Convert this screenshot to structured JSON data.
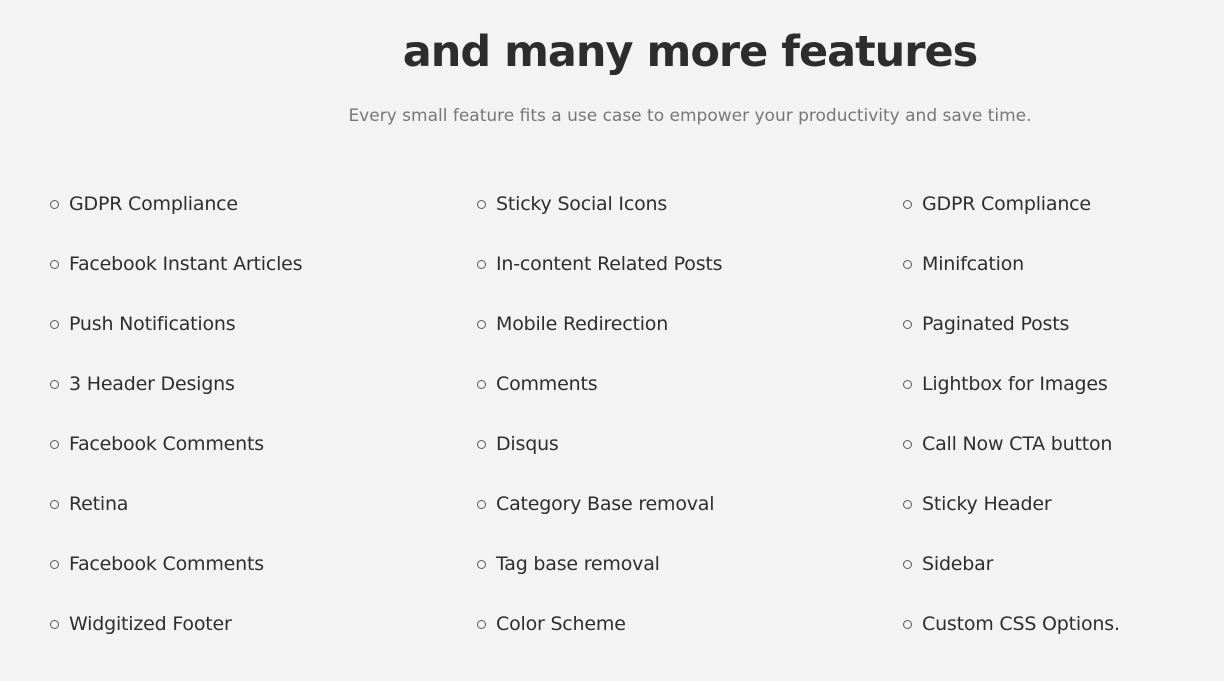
{
  "header": {
    "title": "and many more features",
    "subtitle": "Every small feature fits a use case to empower your productivity and save time."
  },
  "features": {
    "columns": [
      {
        "items": [
          {
            "label": "GDPR Compliance"
          },
          {
            "label": "Facebook Instant Articles"
          },
          {
            "label": "Push Notifications"
          },
          {
            "label": "3 Header Designs"
          },
          {
            "label": "Facebook Comments"
          },
          {
            "label": "Retina"
          },
          {
            "label": "Facebook Comments"
          },
          {
            "label": "Widgitized Footer"
          }
        ]
      },
      {
        "items": [
          {
            "label": "Sticky Social Icons"
          },
          {
            "label": "In-content Related Posts"
          },
          {
            "label": "Mobile Redirection"
          },
          {
            "label": "Comments"
          },
          {
            "label": "Disqus"
          },
          {
            "label": "Category Base removal"
          },
          {
            "label": "Tag base removal"
          },
          {
            "label": "Color Scheme"
          }
        ]
      },
      {
        "items": [
          {
            "label": "GDPR Compliance"
          },
          {
            "label": "Minifcation"
          },
          {
            "label": "Paginated Posts"
          },
          {
            "label": "Lightbox for Images"
          },
          {
            "label": "Call Now CTA button"
          },
          {
            "label": "Sticky Header"
          },
          {
            "label": "Sidebar"
          },
          {
            "label": "Custom CSS Options."
          }
        ]
      }
    ]
  },
  "colors": {
    "background": "#f3f3f3",
    "title": "#2d2d2d",
    "subtitle": "#777777",
    "text": "#2e2e2e",
    "bullet": "#5a5a5a"
  },
  "icons": {
    "bullet": "circle-outline-icon"
  }
}
